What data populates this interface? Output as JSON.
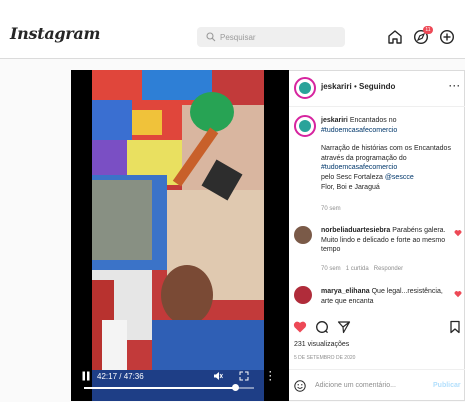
{
  "topbar": {
    "logo": "Instagram",
    "search_placeholder": "Pesquisar",
    "notifications_count": "11",
    "icons": [
      "home-icon",
      "explore-icon",
      "new-post-icon"
    ]
  },
  "video": {
    "time": "42:17 / 47:36",
    "progress": 0.89
  },
  "post": {
    "username": "jeskariri",
    "separator": "•",
    "follow_status": "Seguindo",
    "caption_user": "jeskariri",
    "caption_line1": "Encantados no",
    "caption_tag1": "#tudoemcasafecomercio",
    "caption_line2": "Narração de histórias com os Encantados através da programação do",
    "caption_tag2": "#tudoemcasafecomercio",
    "caption_line3": "pelo Sesc Fortaleza",
    "caption_mention": "@sescce",
    "caption_line4": "Flor, Boi e Jaraguá",
    "caption_age": "70 sem",
    "comments": [
      {
        "user": "norbeliaduartesiebra",
        "text": "Parabéns galera. Muito lindo e delicado e forte ao mesmo tempo",
        "age": "70 sem",
        "likes": "1 curtida",
        "reply": "Responder"
      },
      {
        "user": "marya_elihana",
        "text": "Que legal...resistência, arte que encanta"
      }
    ],
    "views": "231 visualizações",
    "date": "5 de setembro de 2020",
    "comment_placeholder": "Adicione um comentário...",
    "publish_label": "Publicar"
  },
  "colors": {
    "accent_blue": "#0095f6",
    "like_red": "#ed4956",
    "tag_blue": "#00376b"
  }
}
